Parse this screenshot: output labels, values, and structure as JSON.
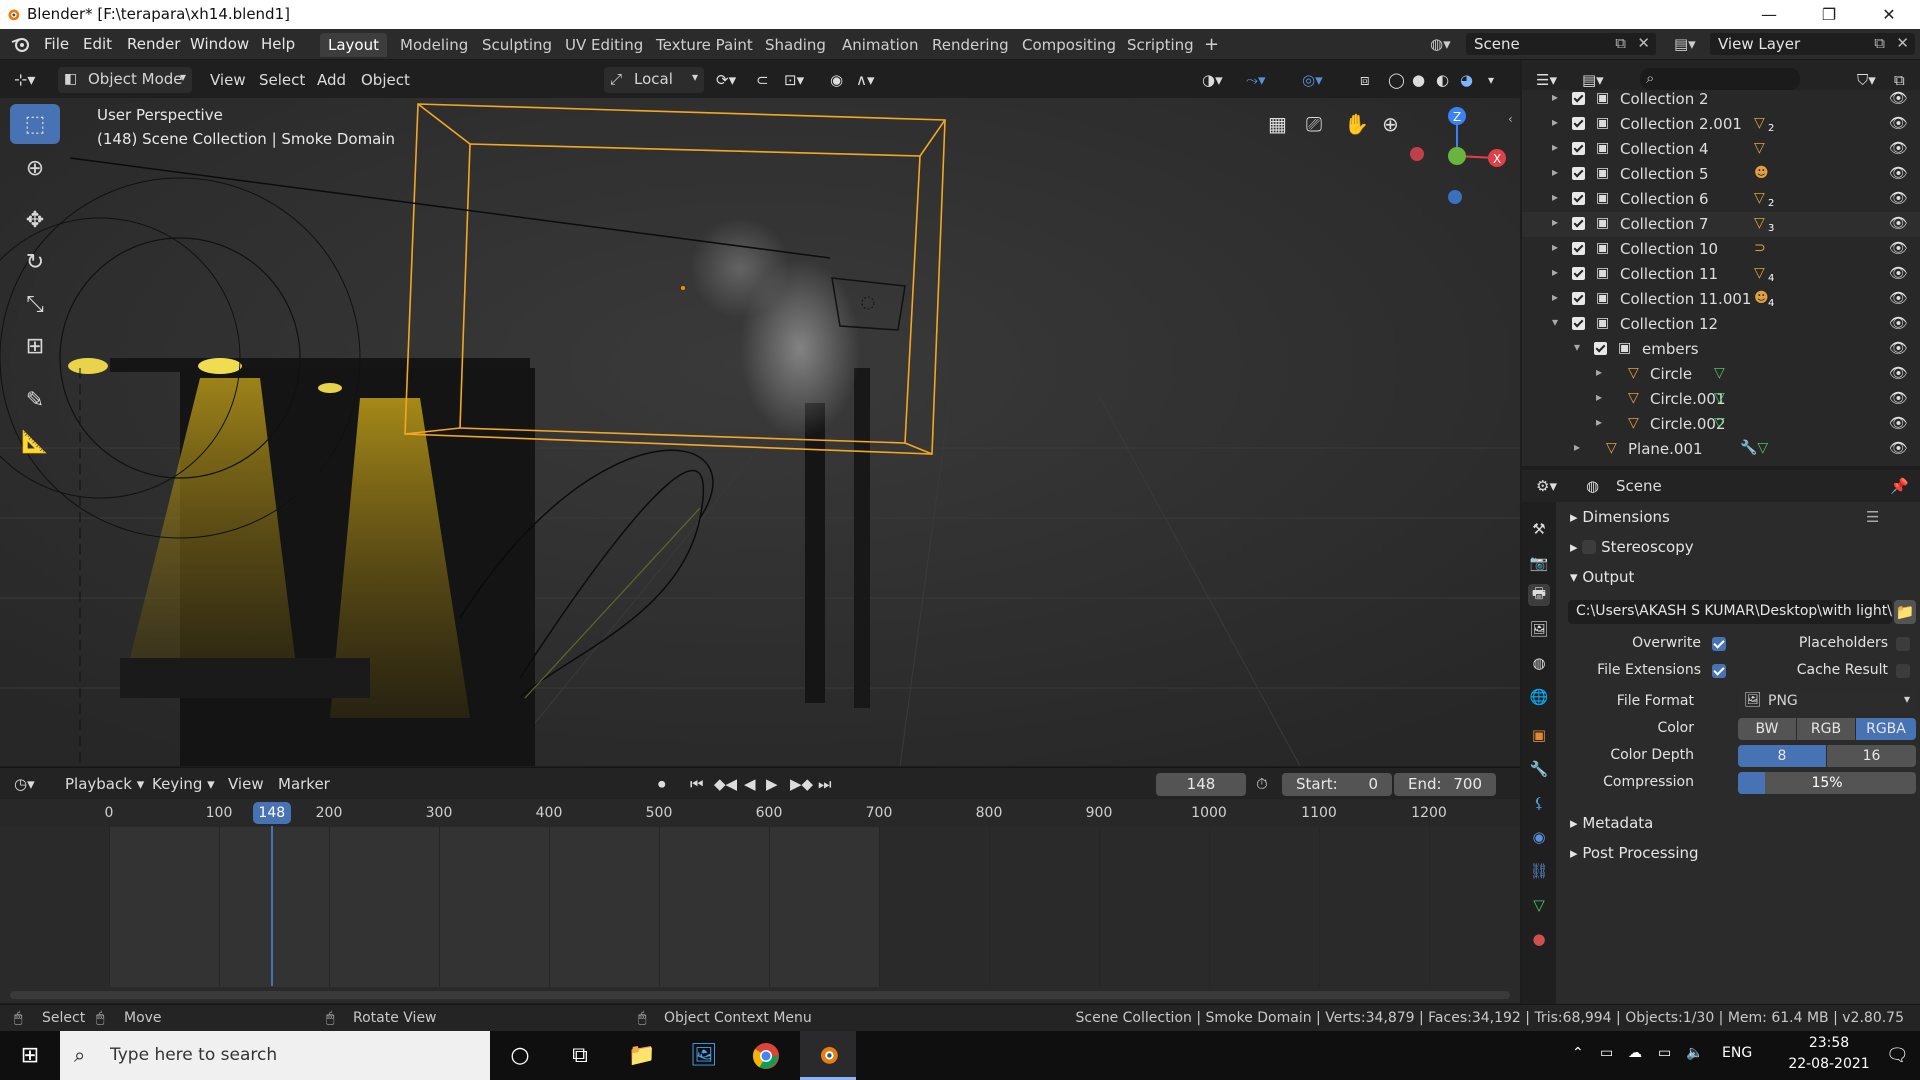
{
  "window": {
    "title": "Blender* [F:\\terapara\\xh14.blend1]",
    "minimize": "—",
    "maximize": "❐",
    "close": "✕"
  },
  "menu": {
    "items": [
      "File",
      "Edit",
      "Render",
      "Window",
      "Help"
    ]
  },
  "workspaces": [
    "Layout",
    "Modeling",
    "Sculpting",
    "UV Editing",
    "Texture Paint",
    "Shading",
    "Animation",
    "Rendering",
    "Compositing",
    "Scripting"
  ],
  "scene_field": "Scene",
  "view_layer_field": "View Layer",
  "viewport_header": {
    "mode": "Object Mode",
    "view": "View",
    "select": "Select",
    "add": "Add",
    "object": "Object",
    "transform_orientation": "Local"
  },
  "viewport": {
    "perspective": "User Perspective",
    "info": "(148) Scene Collection | Smoke Domain"
  },
  "timeline": {
    "playback": "Playback",
    "keying": "Keying",
    "view": "View",
    "marker": "Marker",
    "current_frame": "148",
    "start_label": "Start:",
    "start": "0",
    "end_label": "End:",
    "end": "700",
    "ticks": [
      "0",
      "100",
      "200",
      "300",
      "400",
      "500",
      "600",
      "700",
      "800",
      "900",
      "1000",
      "1100",
      "1200"
    ],
    "frame_badge": "148",
    "current_frame_value": 148,
    "end_frame_value": 700
  },
  "statusbar": {
    "select": "Select",
    "move": "Move",
    "rotate": "Rotate View",
    "context": "Object Context Menu",
    "info": "Scene Collection | Smoke Domain | Verts:34,879 | Faces:34,192 | Tris:68,994 | Objects:1/30 | Mem: 61.4 MB | v2.80.75"
  },
  "outliner": {
    "rows": [
      {
        "label": "Collection 2",
        "level": 0
      },
      {
        "label": "Collection 2.001",
        "level": 0
      },
      {
        "label": "Collection 4",
        "level": 0
      },
      {
        "label": "Collection 5",
        "level": 0
      },
      {
        "label": "Collection 6",
        "level": 0
      },
      {
        "label": "Collection 7",
        "level": 0
      },
      {
        "label": "Collection 10",
        "level": 0
      },
      {
        "label": "Collection 11",
        "level": 0
      },
      {
        "label": "Collection 11.001",
        "level": 0
      },
      {
        "label": "Collection 12",
        "level": 0
      },
      {
        "label": "embers",
        "level": 1
      },
      {
        "label": "Circle",
        "level": 2
      },
      {
        "label": "Circle.001",
        "level": 2
      },
      {
        "label": "Circle.002",
        "level": 2
      },
      {
        "label": "Plane.001",
        "level": 1
      }
    ],
    "badges": [
      "2",
      "2",
      "3",
      "4",
      "2",
      "4",
      "2"
    ]
  },
  "properties": {
    "context": "Scene",
    "panels": {
      "dimensions": "Dimensions",
      "stereoscopy": "Stereoscopy",
      "output": "Output",
      "metadata": "Metadata",
      "post_processing": "Post Processing"
    },
    "output_path": "C:\\Users\\AKASH S KUMAR\\Desktop\\with light\\",
    "overwrite": "Overwrite",
    "placeholders": "Placeholders",
    "file_extensions": "File Extensions",
    "cache_result": "Cache Result",
    "file_format_label": "File Format",
    "file_format": "PNG",
    "color_label": "Color",
    "color_options": [
      "BW",
      "RGB",
      "RGBA"
    ],
    "color_selected": "RGBA",
    "depth_label": "Color Depth",
    "depth_options": [
      "8",
      "16"
    ],
    "depth_selected": "8",
    "compression_label": "Compression",
    "compression": "15%",
    "compression_value": 15
  },
  "taskbar": {
    "search_placeholder": "Type here to search",
    "lang": "ENG",
    "time": "23:58",
    "date": "22-08-2021"
  },
  "colors": {
    "accent": "#4772b3",
    "selection": "#f5a623",
    "light": "#e8d34a"
  }
}
